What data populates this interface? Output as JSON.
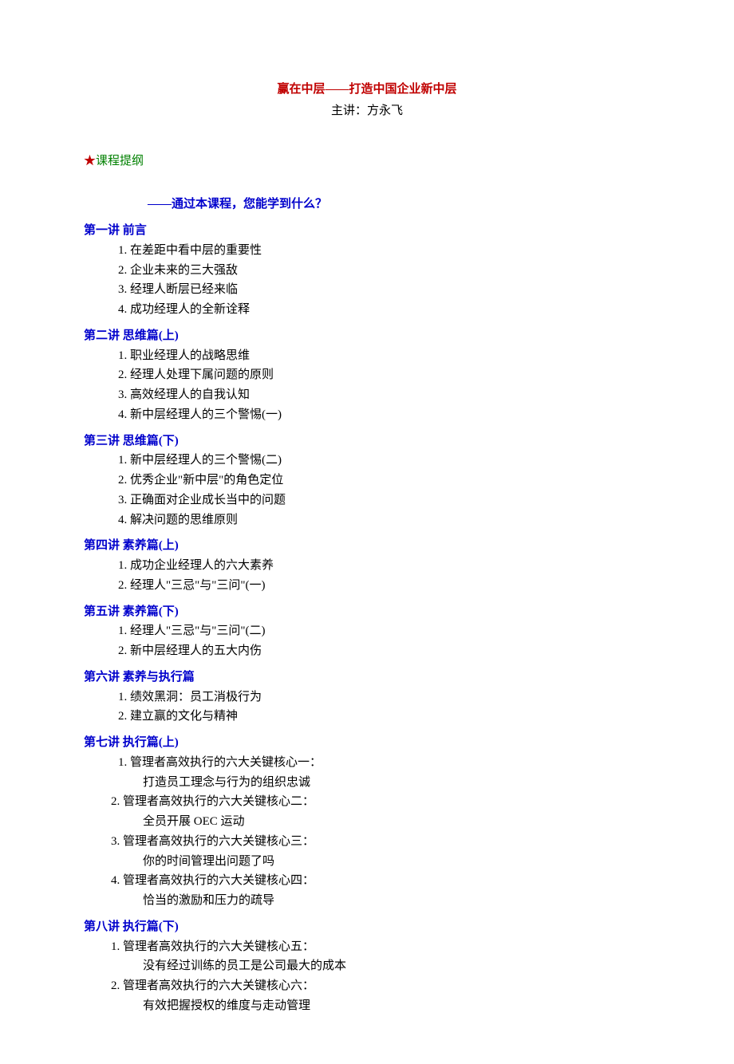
{
  "title": "赢在中层——打造中国企业新中层",
  "presenter": "主讲：方永飞",
  "starSymbol": "★",
  "outlineLabel": "课程提纲",
  "subtitle": "——通过本课程，您能学到什么？",
  "sections": [
    {
      "heading": "第一讲   前言",
      "items": [
        {
          "text": "1.  在差距中看中层的重要性"
        },
        {
          "text": "2.  企业未来的三大强敌"
        },
        {
          "text": "3.  经理人断层已经来临"
        },
        {
          "text": "4.  成功经理人的全新诠释"
        }
      ]
    },
    {
      "heading": "第二讲  思维篇(上)",
      "items": [
        {
          "text": "1.  职业经理人的战略思维"
        },
        {
          "text": "2.  经理人处理下属问题的原则"
        },
        {
          "text": "3.  高效经理人的自我认知"
        },
        {
          "text": "4.  新中层经理人的三个警惕(一)"
        }
      ]
    },
    {
      "heading": "第三讲  思维篇(下)",
      "items": [
        {
          "text": "1.  新中层经理人的三个警惕(二)"
        },
        {
          "text": "2.  优秀企业\"新中层\"的角色定位"
        },
        {
          "text": "3.  正确面对企业成长当中的问题"
        },
        {
          "text": "4.  解决问题的思维原则"
        }
      ]
    },
    {
      "heading": "第四讲  素养篇(上)",
      "items": [
        {
          "text": "1.  成功企业经理人的六大素养"
        },
        {
          "text": "2.  经理人\"三忌\"与\"三问\"(一)"
        }
      ]
    },
    {
      "heading": "第五讲  素养篇(下)",
      "items": [
        {
          "text": "1.  经理人\"三忌\"与\"三问\"(二)"
        },
        {
          "text": "2.  新中层经理人的五大内伤"
        }
      ]
    },
    {
      "heading": "第六讲  素养与执行篇",
      "items": [
        {
          "text": "1.  绩效黑洞：员工消极行为"
        },
        {
          "text": "2.  建立赢的文化与精神"
        }
      ]
    },
    {
      "heading": "第七讲  执行篇(上)",
      "items": [
        {
          "text": "1.  管理者高效执行的六大关键核心一："
        },
        {
          "text": "打造员工理念与行为的组织忠诚",
          "sub": true
        },
        {
          "text": "2. 管理者高效执行的六大关键核心二：",
          "tight": true
        },
        {
          "text": "全员开展 OEC 运动",
          "sub": true
        },
        {
          "text": "3. 管理者高效执行的六大关键核心三：",
          "tight": true
        },
        {
          "text": "你的时间管理出问题了吗",
          "sub": true
        },
        {
          "text": "4. 管理者高效执行的六大关键核心四：",
          "tight": true
        },
        {
          "text": "恰当的激励和压力的疏导",
          "sub": true
        }
      ]
    },
    {
      "heading": "第八讲  执行篇(下)",
      "items": [
        {
          "text": "1. 管理者高效执行的六大关键核心五：",
          "tight": true
        },
        {
          "text": "没有经过训练的员工是公司最大的成本",
          "sub": true
        },
        {
          "text": "2. 管理者高效执行的六大关键核心六：",
          "tight": true
        },
        {
          "text": "有效把握授权的维度与走动管理",
          "sub": true
        }
      ]
    }
  ]
}
